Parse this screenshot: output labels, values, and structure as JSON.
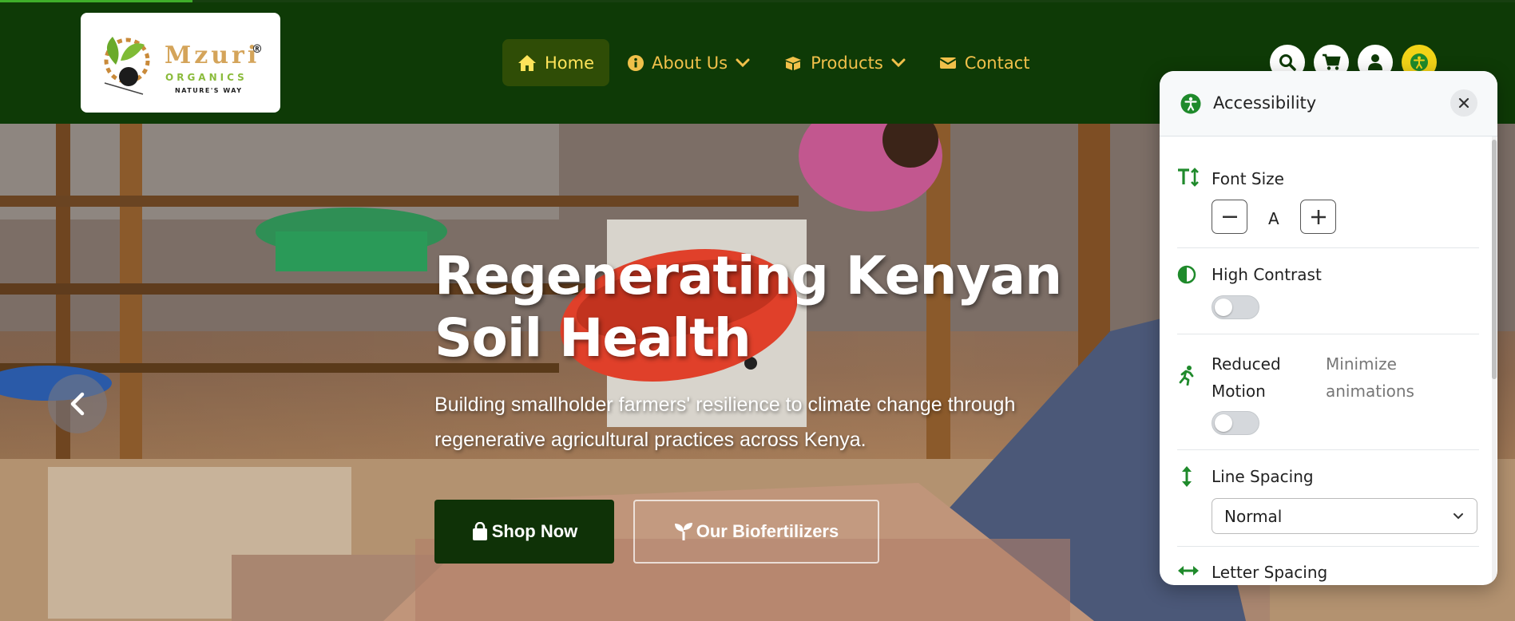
{
  "progress": {
    "fraction": 0.127
  },
  "brand": {
    "name": "Mzuri",
    "registered": "®",
    "sub": "ORGANICS",
    "tagline": "NATURE'S WAY"
  },
  "nav": {
    "items": [
      {
        "label": "Home",
        "icon": "home-icon",
        "active": true,
        "dropdown": false
      },
      {
        "label": "About Us",
        "icon": "info-icon",
        "active": false,
        "dropdown": true
      },
      {
        "label": "Products",
        "icon": "box-icon",
        "active": false,
        "dropdown": true
      },
      {
        "label": "Contact",
        "icon": "envelope-icon",
        "active": false,
        "dropdown": false
      }
    ]
  },
  "header_icons": [
    "search-icon",
    "cart-icon",
    "user-icon",
    "accessibility-icon"
  ],
  "hero": {
    "title": "Regenerating Kenyan Soil Health",
    "subtitle": "Building smallholder farmers' resilience to climate change through regenerative agricultural practices across Kenya.",
    "shop_button": "Shop Now",
    "bio_button": "Our Biofertilizers"
  },
  "accessibility": {
    "title": "Accessibility",
    "font_size": {
      "label": "Font Size",
      "value": "A"
    },
    "high_contrast": {
      "label": "High Contrast",
      "enabled": false
    },
    "reduced_motion": {
      "label": "Reduced Motion",
      "description": "Minimize animations",
      "enabled": false
    },
    "line_spacing": {
      "label": "Line Spacing",
      "selected": "Normal"
    },
    "letter_spacing": {
      "label": "Letter Spacing"
    }
  },
  "colors": {
    "header_bg": "#0e3a06",
    "nav_text": "#f0c04a",
    "nav_active_bg": "#2f4d06",
    "accent_green": "#1f8a2b",
    "accessibility_button": "#f2d317",
    "shop_button_bg": "#0f3207"
  }
}
